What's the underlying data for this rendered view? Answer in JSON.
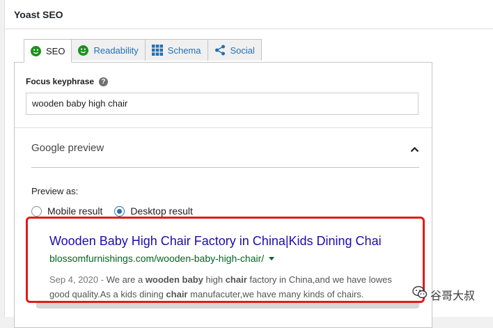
{
  "panel": {
    "title": "Yoast SEO"
  },
  "tabs": [
    {
      "label": "SEO",
      "icon": "smiley-green-icon",
      "active": true
    },
    {
      "label": "Readability",
      "icon": "smiley-green-icon",
      "active": false
    },
    {
      "label": "Schema",
      "icon": "grid-icon",
      "active": false
    },
    {
      "label": "Social",
      "icon": "share-icon",
      "active": false
    }
  ],
  "focus_keyphrase": {
    "label": "Focus keyphrase",
    "help": "?",
    "value": "wooden baby high chair"
  },
  "google_preview": {
    "title": "Google preview",
    "preview_as": "Preview as:",
    "options": [
      "Mobile result",
      "Desktop result"
    ],
    "selected": "Desktop result",
    "serp": {
      "title": "Wooden Baby High Chair Factory in China|Kids Dining Chai",
      "url": "blossomfurnishings.com/wooden-baby-high-chair/",
      "date": "Sep 4, 2020",
      "date_sep": " - ",
      "line1": {
        "t1": "We are a ",
        "b1": "wooden baby",
        "t2": " high ",
        "b2": "chair",
        "t3": " factory in China,and we have lowes"
      },
      "line2": {
        "t1": "good quality.As a kids dining ",
        "b1": "chair",
        "t2": " manufacuter,we have many kinds of chairs."
      }
    }
  },
  "watermark": {
    "text": "谷哥大叔"
  },
  "colors": {
    "link": "#1a0dab",
    "url": "#006621",
    "highlight": "#e11b1b",
    "tab_link": "#2271b1",
    "smiley": "#1e8f1e"
  }
}
